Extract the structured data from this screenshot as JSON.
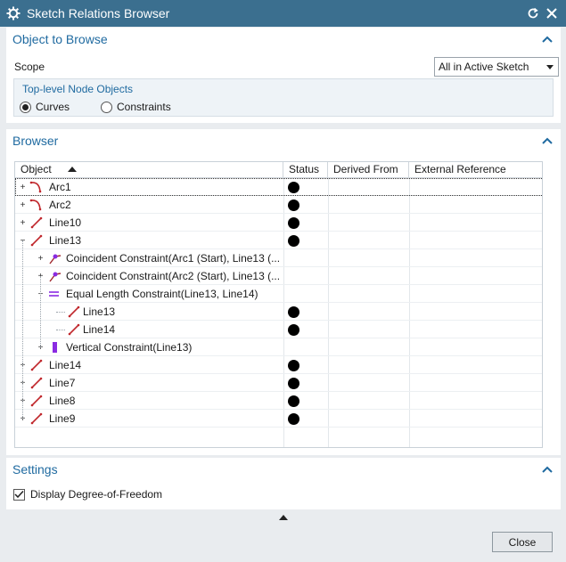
{
  "window": {
    "title": "Sketch Relations Browser",
    "icons": [
      "gear-icon",
      "reset-icon",
      "close-icon"
    ]
  },
  "object_to_browse": {
    "title": "Object to Browse",
    "scope_label": "Scope",
    "scope_value": "All in Active Sketch",
    "group_title": "Top-level Node Objects",
    "radio_curves": "Curves",
    "radio_constraints": "Constraints",
    "selected": "Curves"
  },
  "browser": {
    "title": "Browser",
    "columns": [
      "Object",
      "Status",
      "Derived From",
      "External Reference"
    ],
    "sort": {
      "column": "Object",
      "direction": "ascending"
    },
    "rows": [
      {
        "label": "Arc1",
        "icon": "arc-icon",
        "expander": "+",
        "status": true,
        "level": 0,
        "selected": true
      },
      {
        "label": "Arc2",
        "icon": "arc-icon",
        "expander": "+",
        "status": true,
        "level": 0
      },
      {
        "label": "Line10",
        "icon": "line-icon",
        "expander": "+",
        "status": true,
        "level": 0
      },
      {
        "label": "Line13",
        "icon": "line-icon",
        "expander": "−",
        "status": true,
        "level": 0
      },
      {
        "label": "Coincident Constraint(Arc1 (Start), Line13 (...",
        "icon": "coincident-constraint-icon",
        "expander": "+",
        "status": false,
        "level": 1
      },
      {
        "label": "Coincident Constraint(Arc2 (Start), Line13 (...",
        "icon": "coincident-constraint-icon",
        "expander": "+",
        "status": false,
        "level": 1
      },
      {
        "label": "Equal Length Constraint(Line13, Line14)",
        "icon": "equal-length-icon",
        "expander": "−",
        "status": false,
        "level": 1
      },
      {
        "label": "Line13",
        "icon": "line-icon",
        "expander": "",
        "status": true,
        "level": 2
      },
      {
        "label": "Line14",
        "icon": "line-icon",
        "expander": "",
        "status": true,
        "level": 2
      },
      {
        "label": "Vertical Constraint(Line13)",
        "icon": "vertical-constraint-icon",
        "expander": "+",
        "status": false,
        "level": 1
      },
      {
        "label": "Line14",
        "icon": "line-icon",
        "expander": "+",
        "status": true,
        "level": 0
      },
      {
        "label": "Line7",
        "icon": "line-icon",
        "expander": "+",
        "status": true,
        "level": 0
      },
      {
        "label": "Line8",
        "icon": "line-icon",
        "expander": "+",
        "status": true,
        "level": 0
      },
      {
        "label": "Line9",
        "icon": "line-icon",
        "expander": "+",
        "status": true,
        "level": 0
      }
    ]
  },
  "settings": {
    "title": "Settings",
    "checkbox_label": "Display Degree-of-Freedom",
    "checked": true
  },
  "footer": {
    "close_label": "Close"
  },
  "colors": {
    "titlebar": "#3b6f8f",
    "section_title": "#1f6aa0",
    "curve_icon": "#c0282d",
    "constraint_icon": "#8a2be2"
  }
}
